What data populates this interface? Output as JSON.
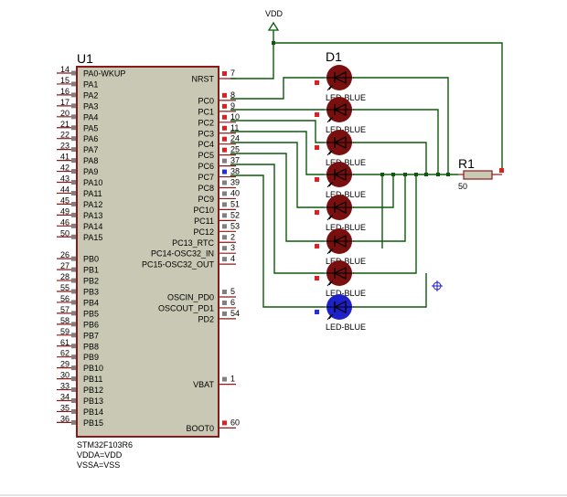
{
  "chip": {
    "ref": "U1",
    "part": "STM32F103R6",
    "notes": [
      "VDDA=VDD",
      "VSSA=VSS"
    ],
    "left_pins": [
      {
        "num": "14",
        "name": "PA0-WKUP"
      },
      {
        "num": "15",
        "name": "PA1"
      },
      {
        "num": "16",
        "name": "PA2"
      },
      {
        "num": "17",
        "name": "PA3"
      },
      {
        "num": "20",
        "name": "PA4"
      },
      {
        "num": "21",
        "name": "PA5"
      },
      {
        "num": "22",
        "name": "PA6"
      },
      {
        "num": "23",
        "name": "PA7"
      },
      {
        "num": "41",
        "name": "PA8"
      },
      {
        "num": "42",
        "name": "PA9"
      },
      {
        "num": "43",
        "name": "PA10"
      },
      {
        "num": "44",
        "name": "PA11"
      },
      {
        "num": "45",
        "name": "PA12"
      },
      {
        "num": "49",
        "name": "PA13"
      },
      {
        "num": "46",
        "name": "PA14"
      },
      {
        "num": "50",
        "name": "PA15"
      },
      {
        "num": "",
        "name": ""
      },
      {
        "num": "26",
        "name": "PB0"
      },
      {
        "num": "27",
        "name": "PB1"
      },
      {
        "num": "28",
        "name": "PB2"
      },
      {
        "num": "55",
        "name": "PB3"
      },
      {
        "num": "56",
        "name": "PB4"
      },
      {
        "num": "57",
        "name": "PB5"
      },
      {
        "num": "58",
        "name": "PB6"
      },
      {
        "num": "59",
        "name": "PB7"
      },
      {
        "num": "61",
        "name": "PB8"
      },
      {
        "num": "62",
        "name": "PB9"
      },
      {
        "num": "29",
        "name": "PB10"
      },
      {
        "num": "30",
        "name": "PB11"
      },
      {
        "num": "33",
        "name": "PB12"
      },
      {
        "num": "34",
        "name": "PB13"
      },
      {
        "num": "35",
        "name": "PB14"
      },
      {
        "num": "36",
        "name": "PB15"
      }
    ],
    "right_pins": [
      {
        "num": "7",
        "name": "NRST",
        "slot": 0
      },
      {
        "num": "8",
        "name": "PC0",
        "slot": 2
      },
      {
        "num": "9",
        "name": "PC1",
        "slot": 3
      },
      {
        "num": "10",
        "name": "PC2",
        "slot": 4
      },
      {
        "num": "11",
        "name": "PC3",
        "slot": 5
      },
      {
        "num": "24",
        "name": "PC4",
        "slot": 6
      },
      {
        "num": "25",
        "name": "PC5",
        "slot": 7
      },
      {
        "num": "37",
        "name": "PC6",
        "slot": 8
      },
      {
        "num": "38",
        "name": "PC7",
        "slot": 9
      },
      {
        "num": "39",
        "name": "PC8",
        "slot": 10
      },
      {
        "num": "40",
        "name": "PC9",
        "slot": 11
      },
      {
        "num": "51",
        "name": "PC10",
        "slot": 12
      },
      {
        "num": "52",
        "name": "PC11",
        "slot": 13
      },
      {
        "num": "53",
        "name": "PC12",
        "slot": 14
      },
      {
        "num": "2",
        "name": "PC13_RTC",
        "slot": 15
      },
      {
        "num": "3",
        "name": "PC14-OSC32_IN",
        "slot": 16
      },
      {
        "num": "4",
        "name": "PC15-OSC32_OUT",
        "slot": 17
      },
      {
        "num": "5",
        "name": "OSCIN_PD0",
        "slot": 20
      },
      {
        "num": "6",
        "name": "OSCOUT_PD1",
        "slot": 21
      },
      {
        "num": "54",
        "name": "PD2",
        "slot": 22
      },
      {
        "num": "1",
        "name": "VBAT",
        "slot": 28
      },
      {
        "num": "60",
        "name": "BOOT0",
        "slot": 32
      }
    ]
  },
  "power": {
    "label": "VDD"
  },
  "resistor": {
    "ref": "R1",
    "value": "50"
  },
  "leds": {
    "ref": "D1",
    "items": [
      {
        "label": "LED-BLUE",
        "state": "off"
      },
      {
        "label": "LED-BLUE",
        "state": "off"
      },
      {
        "label": "LED-BLUE",
        "state": "off"
      },
      {
        "label": "LED-BLUE",
        "state": "off"
      },
      {
        "label": "LED-BLUE",
        "state": "off"
      },
      {
        "label": "LED-BLUE",
        "state": "off"
      },
      {
        "label": "LED-BLUE",
        "state": "off"
      },
      {
        "label": "LED-BLUE",
        "state": "on"
      }
    ]
  },
  "colors": {
    "wire": "#0b5a0b",
    "chip_fill": "#c8c8b4",
    "chip_border": "#8a1a1a",
    "led_off": "#7a0f0f",
    "led_on": "#1f22c8",
    "pin_red": "#e02020",
    "pin_gray": "#808080",
    "pin_blue": "#2030e0",
    "cursor": "#1a1ad0"
  }
}
